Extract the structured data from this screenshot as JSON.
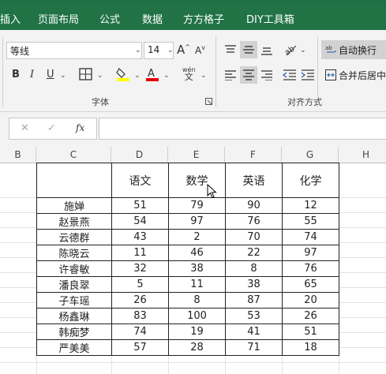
{
  "menu": {
    "items": [
      "插入",
      "页面布局",
      "公式",
      "数据",
      "方方格子",
      "DIY工具箱"
    ]
  },
  "ribbon": {
    "font_name": "等线",
    "font_size": "14",
    "grow_font": "A",
    "shrink_font": "A",
    "bold": "B",
    "italic": "I",
    "underline": "U",
    "phonetic_top": "wén",
    "phonetic_bottom": "文",
    "font_group_label": "字体",
    "align_group_label": "对齐方式",
    "wrap_text": "自动换行",
    "merge_center": "合并后居中",
    "highlight_color": "#ffff00",
    "font_color": "#e60000"
  },
  "formula_bar": {
    "cancel": "✕",
    "enter": "✓",
    "fx": "fx",
    "value": ""
  },
  "columns": [
    "B",
    "C",
    "D",
    "E",
    "F",
    "G",
    "H"
  ],
  "table": {
    "headers": [
      "",
      "语文",
      "数学",
      "英语",
      "化学"
    ],
    "rows": [
      [
        "施婵",
        "51",
        "79",
        "90",
        "12"
      ],
      [
        "赵景燕",
        "54",
        "97",
        "76",
        "55"
      ],
      [
        "云德群",
        "43",
        "2",
        "70",
        "74"
      ],
      [
        "陈晓云",
        "11",
        "46",
        "22",
        "97"
      ],
      [
        "许睿敏",
        "32",
        "38",
        "8",
        "76"
      ],
      [
        "潘良翠",
        "5",
        "11",
        "38",
        "65"
      ],
      [
        "子车瑶",
        "26",
        "8",
        "87",
        "20"
      ],
      [
        "杨鑫琳",
        "83",
        "100",
        "53",
        "26"
      ],
      [
        "韩痴梦",
        "74",
        "19",
        "41",
        "51"
      ],
      [
        "严美美",
        "57",
        "28",
        "71",
        "18"
      ]
    ]
  },
  "colors": {
    "ribbon_green": "#217346",
    "ribbon_bg": "#f3f3f3"
  }
}
